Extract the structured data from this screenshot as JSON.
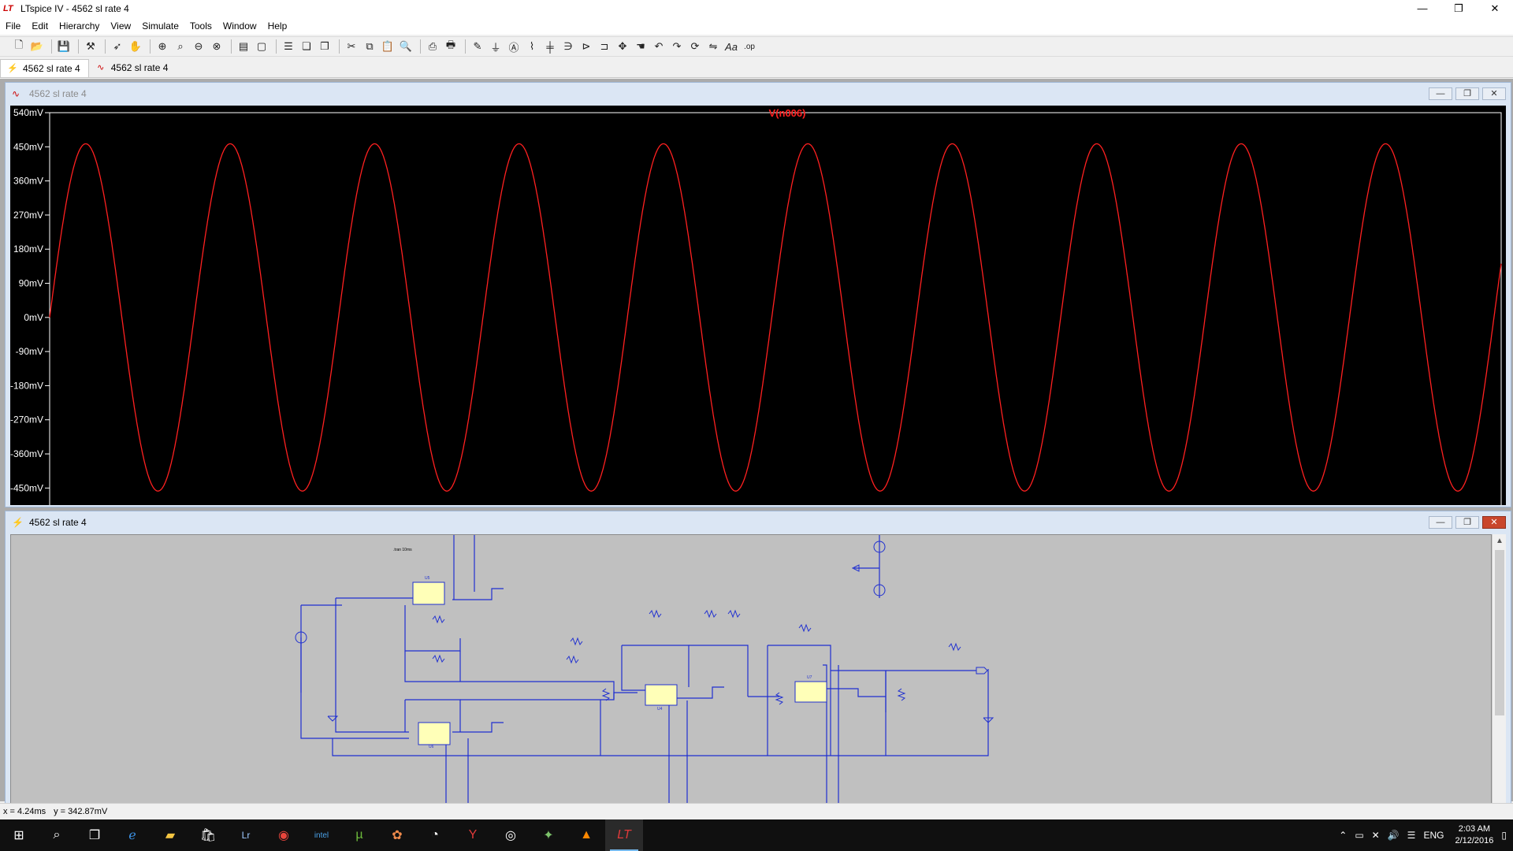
{
  "window": {
    "title": "LTspice IV - 4562  sl rate 4",
    "logo": "LT",
    "controls": {
      "minimize": "—",
      "maximize": "❐",
      "close": "✕"
    }
  },
  "menu": [
    "File",
    "Edit",
    "Hierarchy",
    "View",
    "Simulate",
    "Tools",
    "Window",
    "Help"
  ],
  "toolbar": [
    "new-schematic-icon",
    "open-icon",
    "save-icon",
    "control-panel-icon",
    "run-icon",
    "halt-icon",
    "zoom-in-icon",
    "zoom-pan-icon",
    "zoom-out-icon",
    "zoom-fit-icon",
    "autorange-icon",
    "clear-icon",
    "tile-horizontal-icon",
    "tile-vertical-icon",
    "cascade-icon",
    "cut-icon",
    "copy-icon",
    "paste-icon",
    "find-icon",
    "print-preview-icon",
    "print-icon",
    "draw-wire-icon",
    "ground-icon",
    "label-icon",
    "resistor-icon",
    "capacitor-icon",
    "inductor-icon",
    "diode-icon",
    "component-icon",
    "move-icon",
    "drag-icon",
    "undo-icon",
    "redo-icon",
    "rotate-icon",
    "mirror-icon",
    "text-icon",
    "spice-directive-icon"
  ],
  "tabs": [
    {
      "label": "4562  sl rate 4",
      "icon": "schematic-icon"
    },
    {
      "label": "4562  sl rate 4",
      "icon": "waveform-icon"
    }
  ],
  "waveform_window": {
    "title": "4562  sl rate 4",
    "trace_label": "V(n006)",
    "colors": {
      "trace": "#ff2020",
      "background": "#000000",
      "axis": "#ffffff"
    }
  },
  "schematic_window": {
    "title": "4562  sl rate 4"
  },
  "status": {
    "x": "x = 4.24ms",
    "y": "y = 342.87mV"
  },
  "taskbar": {
    "apps": [
      "windows-start-icon",
      "search-icon",
      "task-view-icon",
      "edge-icon",
      "file-explorer-icon",
      "store-icon",
      "lightroom-icon",
      "chrome-icon",
      "intel-icon",
      "utorrent-icon",
      "paint-icon",
      "app-icon",
      "app-red-icon",
      "media-icon",
      "gaming-icon",
      "vlc-icon",
      "ltspice-icon"
    ],
    "tray": {
      "language": "ENG",
      "time": "2:03 AM",
      "date": "2/12/2016"
    }
  },
  "chart_data": {
    "type": "line",
    "title": "V(n006)",
    "ylabel": "",
    "xlabel": "",
    "ylim": [
      -495,
      540
    ],
    "yticks": [
      "540mV",
      "450mV",
      "360mV",
      "270mV",
      "180mV",
      "90mV",
      "0mV",
      "-90mV",
      "-180mV",
      "-270mV",
      "-360mV",
      "-450mV"
    ],
    "ytick_values": [
      540,
      450,
      360,
      270,
      180,
      90,
      0,
      -90,
      -180,
      -270,
      -360,
      -450
    ],
    "series": [
      {
        "amplitude_mV": 458,
        "cycles": 10.05,
        "phase": "starts at 0mV rising"
      }
    ]
  }
}
